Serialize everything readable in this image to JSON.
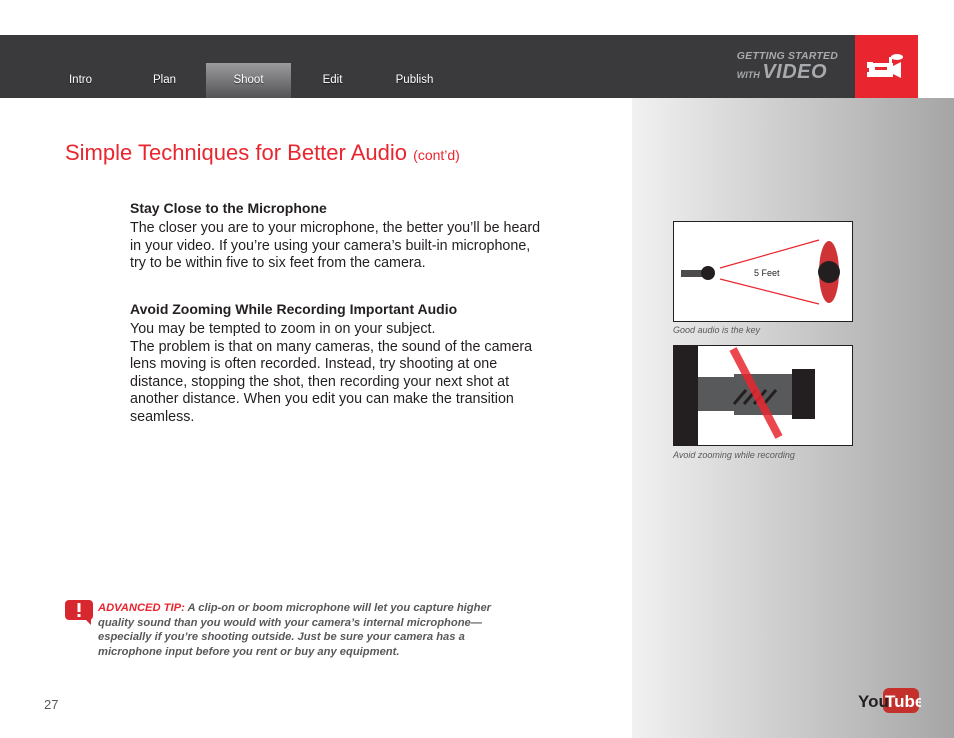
{
  "nav": {
    "items": [
      {
        "label": "Intro",
        "active": false
      },
      {
        "label": "Plan",
        "active": false
      },
      {
        "label": "Shoot",
        "active": true
      },
      {
        "label": "Edit",
        "active": false
      },
      {
        "label": "Publish",
        "active": false
      }
    ]
  },
  "brand": {
    "line1": "GETTING STARTED",
    "line2_small": "WITH",
    "line2_big": "VIDEO",
    "icon": "video-camera-icon"
  },
  "page": {
    "title": "Simple Techniques for Better Audio",
    "title_suffix": "(cont’d)",
    "sections": [
      {
        "heading": "Stay Close to the Microphone",
        "body": "The closer you are to your microphone, the better you’ll be heard in your video. If you’re using your camera’s built-in microphone, try to be within five to six feet from the camera."
      },
      {
        "heading": "Avoid Zooming While Recording Important Audio",
        "body_line1": "You may be tempted to zoom in on your subject.",
        "body": "The problem is that on many cameras, the sound of the camera lens moving is often recorded. Instead, try shooting at one distance, stopping the shot, then recording your next shot at another distance. When you edit you can make the transition seamless."
      }
    ],
    "figures": [
      {
        "label": "5 Feet",
        "caption": "Good audio is the key"
      },
      {
        "caption": "Avoid zooming while recording"
      }
    ],
    "tip": {
      "icon": "alert-speech-bubble-icon",
      "label": "ADVANCED TIP:",
      "text": " A clip-on or boom microphone will let you capture higher quality sound than you would with your camera’s internal microphone—especially if you’re shooting outside. Just be sure your camera has a microphone input before you rent or buy any equipment."
    },
    "page_number": "27"
  },
  "footer": {
    "logo_you": "You",
    "logo_tube": "Tube"
  },
  "colors": {
    "accent": "#e9262f",
    "nav_bg": "#3a3a3c",
    "text": "#231f20",
    "muted": "#58595b"
  }
}
